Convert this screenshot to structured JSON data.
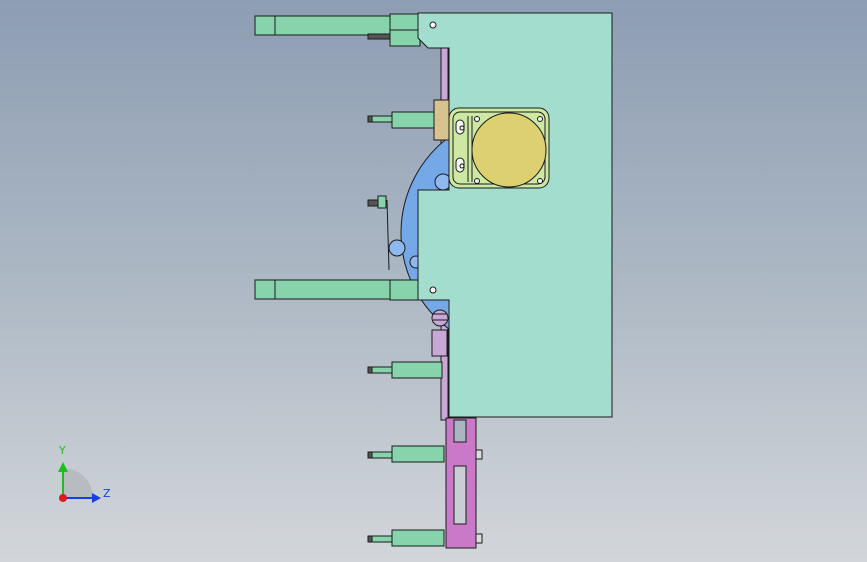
{
  "viewport": {
    "background_top": "#8d9db3",
    "background_bottom": "#d2d6da"
  },
  "part_colors": {
    "main_plate": "#a2ddcd",
    "arms": "#86d3ac",
    "rotary_disc": "#74a8e6",
    "motor_flange": "#cde8a3",
    "motor_face": "#dcd070",
    "slider_bracket": "#c979c8",
    "thin_plate": "#c9a7d6",
    "outline": "#1b1b1b"
  },
  "triad": {
    "y_label": "Y",
    "z_label": "Z",
    "y_color": "#18c018",
    "z_color": "#1a3fe0",
    "origin_color": "#e01818"
  }
}
